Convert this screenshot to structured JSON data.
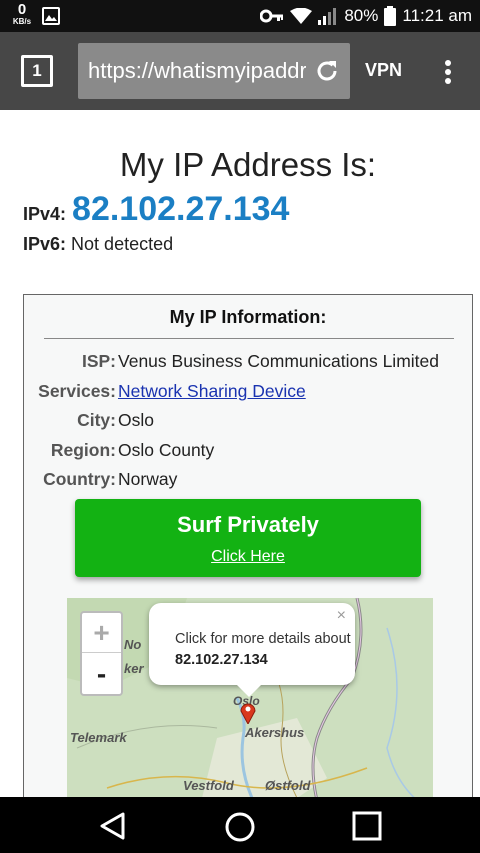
{
  "status_bar": {
    "kbs_value": "0",
    "kbs_unit": "KB/s",
    "battery": "80%",
    "time": "11:21 am",
    "icons": [
      "image-icon",
      "key-icon",
      "wifi-icon",
      "signal-icon",
      "battery-icon"
    ]
  },
  "browser": {
    "tab_count": "1",
    "url": "https://whatismyipaddress.com",
    "vpn_label": "VPN"
  },
  "page": {
    "headline": "My IP Address Is:",
    "ipv4_label": "IPv4:",
    "ipv4_value": "82.102.27.134",
    "ipv6_label": "IPv6:",
    "ipv6_value": "Not detected",
    "accent_color": "#1b7fc4"
  },
  "info": {
    "title": "My IP Information:",
    "rows": [
      {
        "label": "ISP:",
        "value": "Venus Business Communications Limited"
      },
      {
        "label": "Services:",
        "value": "Network Sharing Device"
      },
      {
        "label": "City:",
        "value": "Oslo"
      },
      {
        "label": "Region:",
        "value": "Oslo County"
      },
      {
        "label": "Country:",
        "value": "Norway"
      }
    ]
  },
  "cta": {
    "title": "Surf Privately",
    "subtitle": "Click Here",
    "color": "#13b213"
  },
  "map": {
    "zoom_in": "+",
    "zoom_out": "-",
    "popup_text": "Click for more details about",
    "popup_ip": "82.102.27.134",
    "popup_close": "×",
    "labels": [
      "No",
      "ker",
      "Oslo",
      "Akershus",
      "Telemark",
      "Vestfold",
      "Østfold"
    ]
  }
}
